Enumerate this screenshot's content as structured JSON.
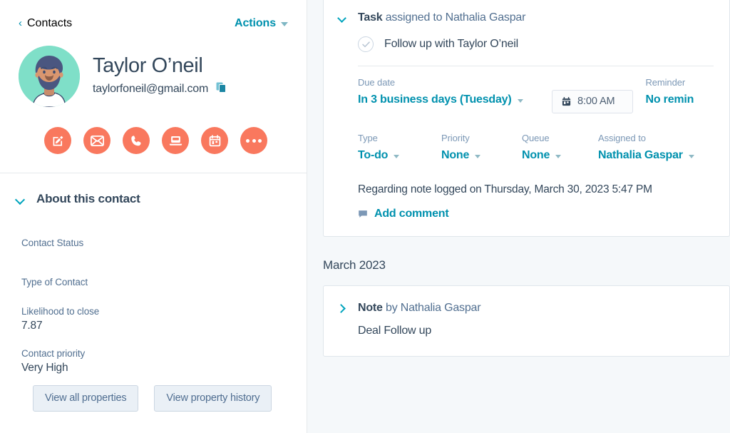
{
  "left_panel": {
    "breadcrumb": {
      "back_icon": "chevron-left-icon",
      "label": "Contacts"
    },
    "actions": {
      "label": "Actions",
      "caret_icon": "caret-down-icon"
    },
    "contact": {
      "avatar_alt": "contact-avatar",
      "name": "Taylor O’neil",
      "email": "taylorfoneil@gmail.com",
      "copy_icon": "copy-icon"
    },
    "quick_actions": [
      {
        "name": "note-button",
        "icon": "note-edit-icon"
      },
      {
        "name": "email-button",
        "icon": "envelope-icon"
      },
      {
        "name": "call-button",
        "icon": "phone-icon"
      },
      {
        "name": "meeting-button",
        "icon": "laptop-icon"
      },
      {
        "name": "task-button",
        "icon": "calendar-icon"
      },
      {
        "name": "more-button",
        "icon": "ellipsis-icon"
      }
    ],
    "about": {
      "toggle_icon": "chevron-down-icon",
      "title": "About this contact",
      "properties": [
        {
          "label": "Contact Status",
          "value": ""
        },
        {
          "label": "Type of Contact",
          "value": ""
        },
        {
          "label": "Likelihood to close",
          "value": "7.87"
        },
        {
          "label": "Contact priority",
          "value": "Very High"
        }
      ],
      "buttons": [
        {
          "label": "View all properties"
        },
        {
          "label": "View property history"
        }
      ]
    }
  },
  "right_panel": {
    "task": {
      "toggle_icon": "chevron-down-icon",
      "header_type": "Task",
      "header_rest": " assigned to Nathalia Gaspar",
      "checkbox_icon": "check-circle-icon",
      "name": "Follow up with Taylor O’neil",
      "due_date": {
        "label": "Due date",
        "value": "In 3 business days (Tuesday)",
        "caret_icon": "caret-down-icon",
        "time_icon": "calendar-clock-icon",
        "time_value": "8:00 AM"
      },
      "reminder": {
        "label": "Reminder",
        "value": "No remin"
      },
      "fields": [
        {
          "label": "Type",
          "value": "To-do"
        },
        {
          "label": "Priority",
          "value": "None"
        },
        {
          "label": "Queue",
          "value": "None"
        },
        {
          "label": "Assigned to",
          "value": "Nathalia Gaspar"
        }
      ],
      "regarding": "Regarding note logged on Thursday, March 30, 2023 5:47 PM",
      "add_comment": {
        "icon": "comment-bubble-icon",
        "label": "Add comment"
      }
    },
    "month_divider": "March 2023",
    "note": {
      "toggle_icon": "chevron-right-icon",
      "header_type": "Note",
      "header_rest": " by Nathalia Gaspar",
      "body": "Deal Follow up"
    }
  },
  "colors": {
    "accent_orange": "#F9785E",
    "link_teal": "#0091AE",
    "text_dark": "#33475B",
    "text_muted": "#516F90",
    "panel_bg": "#F5F8FA",
    "avatar_bg": "#7FDFC8"
  }
}
